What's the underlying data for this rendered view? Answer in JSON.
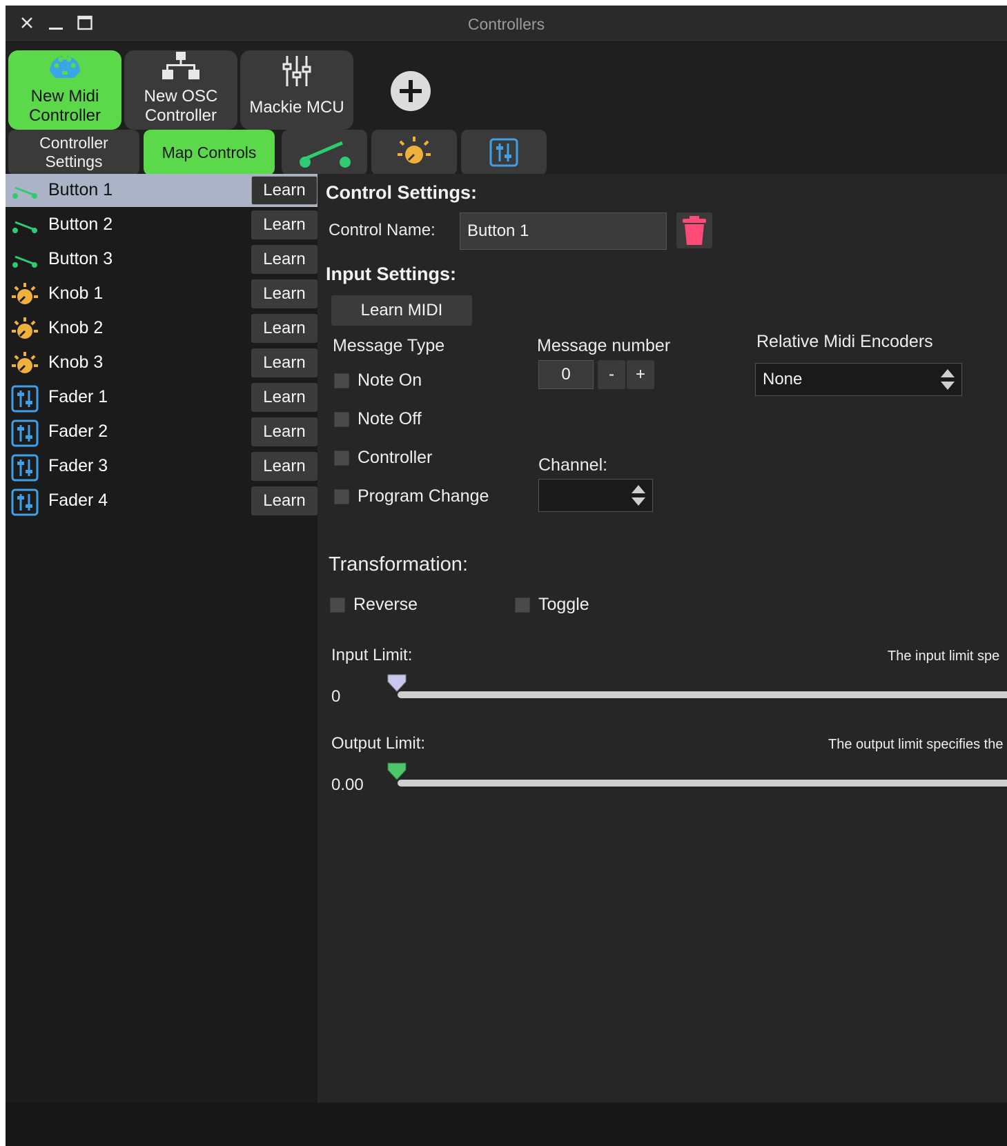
{
  "window": {
    "title": "Controllers"
  },
  "controller_tabs": [
    {
      "label1": "New Midi",
      "label2": "Controller",
      "icon": "midi-icon"
    },
    {
      "label1": "New OSC",
      "label2": "Controller",
      "icon": "network-icon"
    },
    {
      "label1": "",
      "label2": "Mackie MCU",
      "icon": "mixer-icon"
    }
  ],
  "sub_tabs": {
    "settings_line1": "Controller",
    "settings_line2": "Settings",
    "map": "Map Controls"
  },
  "controls": [
    {
      "label": "Button 1",
      "type": "button",
      "learn": "Learn"
    },
    {
      "label": "Button 2",
      "type": "button",
      "learn": "Learn"
    },
    {
      "label": "Button 3",
      "type": "button",
      "learn": "Learn"
    },
    {
      "label": "Knob 1",
      "type": "knob",
      "learn": "Learn"
    },
    {
      "label": "Knob 2",
      "type": "knob",
      "learn": "Learn"
    },
    {
      "label": "Knob 3",
      "type": "knob",
      "learn": "Learn"
    },
    {
      "label": "Fader 1",
      "type": "fader",
      "learn": "Learn"
    },
    {
      "label": "Fader 2",
      "type": "fader",
      "learn": "Learn"
    },
    {
      "label": "Fader 3",
      "type": "fader",
      "learn": "Learn"
    },
    {
      "label": "Fader 4",
      "type": "fader",
      "learn": "Learn"
    }
  ],
  "control_settings": {
    "heading": "Control Settings:",
    "name_label": "Control Name:",
    "name_value": "Button 1"
  },
  "input_settings": {
    "heading": "Input Settings:",
    "learn_midi": "Learn MIDI",
    "message_type_label": "Message Type",
    "message_types": [
      "Note On",
      "Note Off",
      "Controller",
      "Program Change"
    ],
    "message_number_label": "Message number",
    "message_number": "0",
    "minus": "-",
    "plus": "+",
    "channel_label": "Channel:",
    "channel_value": "",
    "relative_label": "Relative Midi Encoders",
    "relative_value": "None"
  },
  "transformation": {
    "heading": "Transformation:",
    "reverse": "Reverse",
    "toggle": "Toggle",
    "input_limit_label": "Input Limit:",
    "input_limit_value": "0",
    "input_hint": "The input limit spe",
    "output_limit_label": "Output Limit:",
    "output_limit_value": "0.00",
    "output_hint": "The output limit specifies the"
  },
  "colors": {
    "accent_green": "#5bd94a",
    "button_icon": "#2ecc71",
    "knob_icon": "#f0b03c",
    "fader_icon": "#3fa0e8",
    "delete_red": "#ff4a78"
  }
}
